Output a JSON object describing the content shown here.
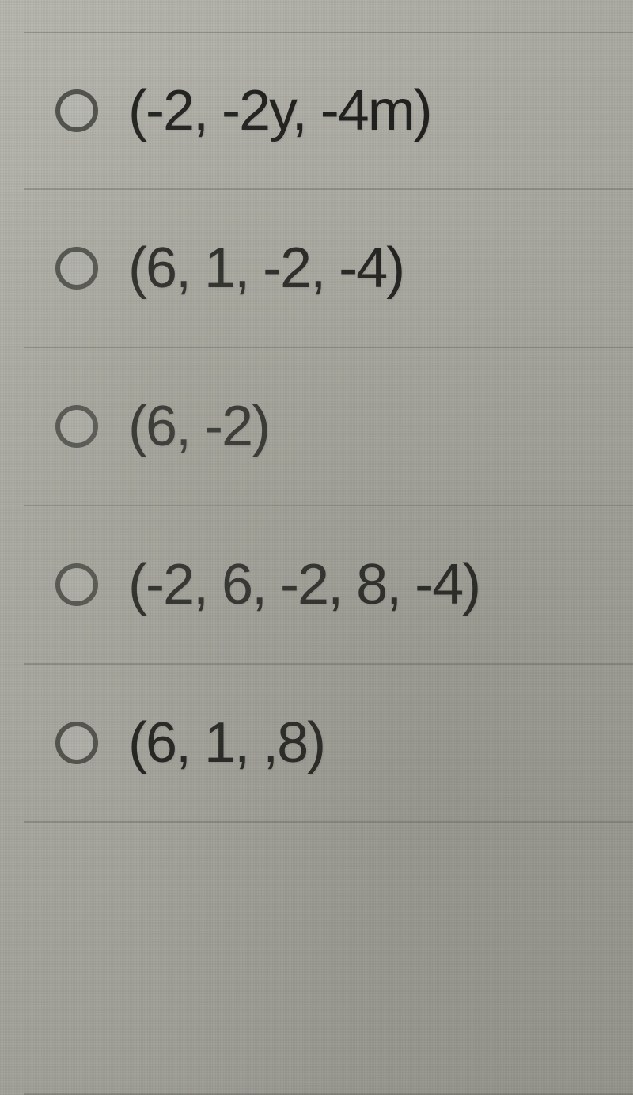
{
  "options": [
    {
      "label": "(-2, -2y, -4m)"
    },
    {
      "label": "(6, 1, -2, -4)"
    },
    {
      "label": "(6, -2)"
    },
    {
      "label": "(-2, 6, -2, 8, -4)"
    },
    {
      "label": "(6, 1, ,8)"
    }
  ]
}
